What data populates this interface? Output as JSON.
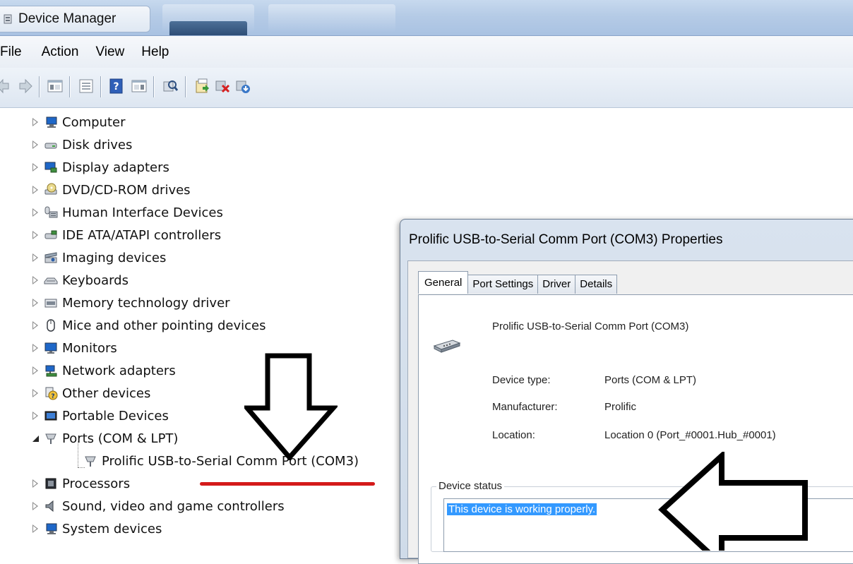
{
  "window": {
    "title": "Device Manager"
  },
  "menu": {
    "items": [
      "File",
      "Action",
      "View",
      "Help"
    ]
  },
  "toolbar": {
    "icons": [
      "back-icon",
      "forward-icon",
      "show-hide-console-tree-icon",
      "properties-icon",
      "help-icon",
      "action-pane-icon",
      "scan-hardware-changes-icon",
      "update-driver-icon",
      "uninstall-device-icon",
      "enable-device-icon"
    ]
  },
  "tree": {
    "items": [
      {
        "label": "Computer",
        "icon": "computer-icon",
        "state": "collapsed"
      },
      {
        "label": "Disk drives",
        "icon": "disk-drive-icon",
        "state": "collapsed"
      },
      {
        "label": "Display adapters",
        "icon": "display-adapter-icon",
        "state": "collapsed"
      },
      {
        "label": "DVD/CD-ROM drives",
        "icon": "dvd-drive-icon",
        "state": "collapsed"
      },
      {
        "label": "Human Interface Devices",
        "icon": "hid-icon",
        "state": "collapsed"
      },
      {
        "label": "IDE ATA/ATAPI controllers",
        "icon": "ide-controller-icon",
        "state": "collapsed"
      },
      {
        "label": "Imaging devices",
        "icon": "imaging-device-icon",
        "state": "collapsed"
      },
      {
        "label": "Keyboards",
        "icon": "keyboard-icon",
        "state": "collapsed"
      },
      {
        "label": "Memory technology driver",
        "icon": "memory-icon",
        "state": "collapsed"
      },
      {
        "label": "Mice and other pointing devices",
        "icon": "mouse-icon",
        "state": "collapsed"
      },
      {
        "label": "Monitors",
        "icon": "monitor-icon",
        "state": "collapsed"
      },
      {
        "label": "Network adapters",
        "icon": "network-adapter-icon",
        "state": "collapsed"
      },
      {
        "label": "Other devices",
        "icon": "unknown-device-icon",
        "state": "collapsed"
      },
      {
        "label": "Portable Devices",
        "icon": "portable-device-icon",
        "state": "collapsed"
      },
      {
        "label": "Ports (COM & LPT)",
        "icon": "port-icon",
        "state": "expanded"
      },
      {
        "label": "Prolific USB-to-Serial Comm Port (COM3)",
        "icon": "serial-port-icon",
        "state": "child"
      },
      {
        "label": "Processors",
        "icon": "processor-icon",
        "state": "collapsed"
      },
      {
        "label": "Sound, video and game controllers",
        "icon": "speaker-icon",
        "state": "collapsed"
      },
      {
        "label": "System devices",
        "icon": "system-device-icon",
        "state": "collapsed"
      }
    ]
  },
  "dialog": {
    "title": "Prolific USB-to-Serial Comm Port (COM3) Properties",
    "tabs": [
      "General",
      "Port Settings",
      "Driver",
      "Details"
    ],
    "active_tab": "General",
    "device_name": "Prolific USB-to-Serial Comm Port (COM3)",
    "properties": [
      {
        "label": "Device type:",
        "value": "Ports (COM & LPT)"
      },
      {
        "label": "Manufacturer:",
        "value": "Prolific"
      },
      {
        "label": "Location:",
        "value": "Location 0 (Port_#0001.Hub_#0001)"
      }
    ],
    "status_group_label": "Device status",
    "status_text": "This device is working properly."
  },
  "colors": {
    "selection": "#3399ff",
    "annotation_underline": "#d41a1a"
  }
}
